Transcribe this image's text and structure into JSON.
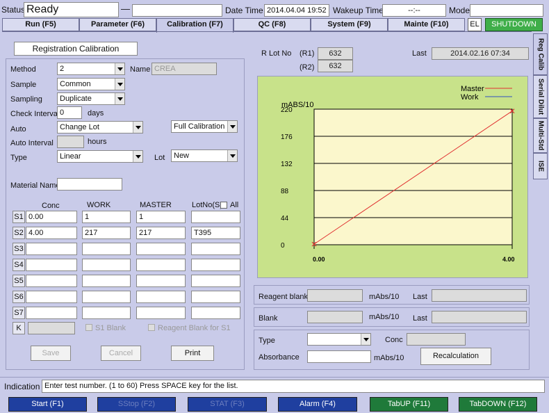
{
  "status_bar": {
    "status_label": "Status",
    "status_value": "Ready",
    "dash": "—",
    "datetime_label": "Date Time",
    "datetime_value": "2014.04.04 19:52",
    "wakeup_label": "Wakeup Time",
    "wakeup_value": "--:--",
    "mode_label": "Mode"
  },
  "tabs": [
    {
      "label": "Run (F5)"
    },
    {
      "label": "Parameter (F6)"
    },
    {
      "label": "Calibration (F7)"
    },
    {
      "label": "QC (F8)"
    },
    {
      "label": "System (F9)"
    },
    {
      "label": "Mainte (F10)"
    }
  ],
  "el_label": "EL",
  "shutdown_label": "SHUTDOWN",
  "side_tabs": [
    {
      "label": "Reg Calib"
    },
    {
      "label": "Serial Dilut"
    },
    {
      "label": "Multi-Std"
    },
    {
      "label": "ISE"
    }
  ],
  "left": {
    "title": "Registration Calibration",
    "method_label": "Method",
    "method_value": "2",
    "name_label": "Name",
    "name_value": "CREA",
    "sample_label": "Sample",
    "sample_value": "Common",
    "sampling_label": "Sampling",
    "sampling_value": "Duplicate",
    "check_interval_label": "Check Interval",
    "check_interval_value": "0",
    "days_label": "days",
    "auto_label": "Auto",
    "auto_value": "Change Lot",
    "full_cal_value": "Full Calibration",
    "auto_interval_label": "Auto Interval",
    "hours_label": "hours",
    "type_label": "Type",
    "type_value": "Linear",
    "lot_label": "Lot",
    "lot_value": "New",
    "material_name_label": "Material Name",
    "col_conc": "Conc",
    "col_work": "WORK",
    "col_master": "MASTER",
    "col_lotno": "LotNo(S)",
    "all_label": "All",
    "rows": [
      {
        "id": "S1",
        "conc": "0.00",
        "work": "1",
        "master": "1",
        "lot": ""
      },
      {
        "id": "S2",
        "conc": "4.00",
        "work": "217",
        "master": "217",
        "lot": "T395"
      },
      {
        "id": "S3",
        "conc": "",
        "work": "",
        "master": "",
        "lot": ""
      },
      {
        "id": "S4",
        "conc": "",
        "work": "",
        "master": "",
        "lot": ""
      },
      {
        "id": "S5",
        "conc": "",
        "work": "",
        "master": "",
        "lot": ""
      },
      {
        "id": "S6",
        "conc": "",
        "work": "",
        "master": "",
        "lot": ""
      },
      {
        "id": "S7",
        "conc": "",
        "work": "",
        "master": "",
        "lot": ""
      }
    ],
    "k_label": "K",
    "s1_blank_label": "S1 Blank",
    "reagent_blank_s1_label": "Reagent Blank for S1",
    "save_label": "Save",
    "cancel_label": "Cancel",
    "print_label": "Print"
  },
  "right": {
    "rlot_label": "R Lot No",
    "r1_label": "(R1)",
    "r1_value": "632",
    "r2_label": "(R2)",
    "r2_value": "632",
    "last_label": "Last",
    "last_value": "2014.02.16 07:34",
    "reagent_blank_label": "Reagent blank",
    "mabs_label": "mAbs/10",
    "last2_label": "Last",
    "blank_label": "Blank",
    "mabs2_label": "mAbs/10",
    "last3_label": "Last",
    "type_label": "Type",
    "conc_label": "Conc",
    "absorbance_label": "Absorbance",
    "mabs3_label": "mAbs/10",
    "recalc_label": "Recalculation"
  },
  "chart_data": {
    "type": "line",
    "ylabel": "mABS/10",
    "yticks": [
      0,
      44,
      88,
      132,
      176,
      220
    ],
    "xticks": [
      "0.00",
      "4.00"
    ],
    "xlim": [
      0,
      4
    ],
    "ylim": [
      0,
      220
    ],
    "grid": true,
    "legend_position": "top-right",
    "series": [
      {
        "name": "Master",
        "color": "#e03030",
        "x": [
          0,
          4
        ],
        "y": [
          1,
          217
        ]
      },
      {
        "name": "Work",
        "color": "#3050c0",
        "x": [
          0,
          4
        ],
        "y": [
          1,
          217
        ]
      }
    ]
  },
  "indication": {
    "label": "Indication",
    "text": "Enter test number. (1 to 60) Press SPACE key for the list."
  },
  "function_keys": [
    {
      "label": "Start (F1)"
    },
    {
      "label": "SStop (F2)"
    },
    {
      "label": "STAT (F3)"
    },
    {
      "label": "Alarm (F4)"
    },
    {
      "label": "TabUP (F11)"
    },
    {
      "label": "TabDOWN (F12)"
    }
  ],
  "colors": {
    "background": "#c9cbe9",
    "chart_bg": "#c8e28a",
    "plot_bg": "#fbf7cc",
    "shutdown": "#3fae49",
    "fkey_blue": "#1f3f9f",
    "fkey_green": "#1f7a3a"
  }
}
